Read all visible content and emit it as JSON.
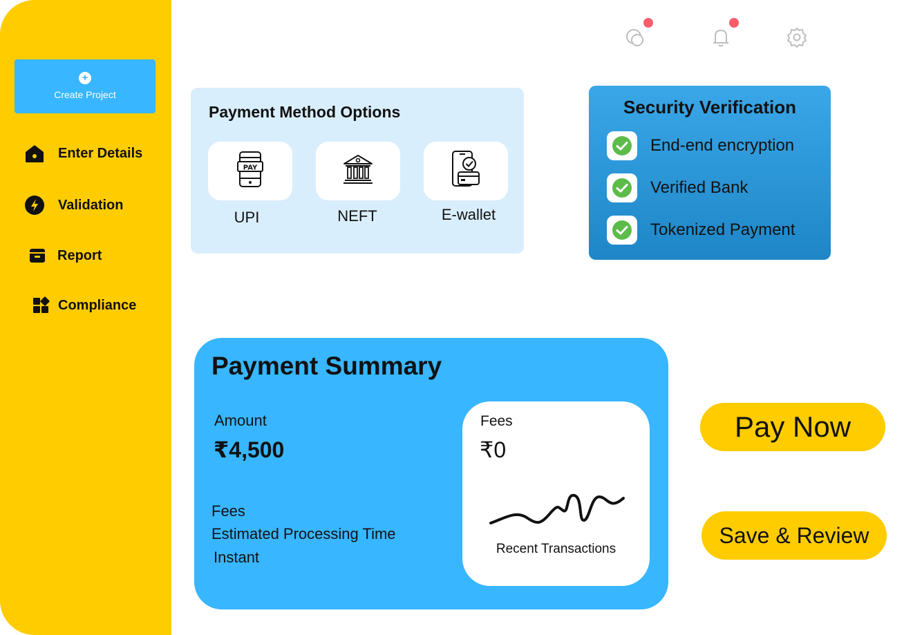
{
  "sidebar": {
    "create_label": "Create Project",
    "items": [
      {
        "label": "Enter Details",
        "icon": "home-icon"
      },
      {
        "label": "Validation",
        "icon": "lightning-icon"
      },
      {
        "label": "Report",
        "icon": "archive-icon"
      },
      {
        "label": "Compliance",
        "icon": "grid-icon"
      }
    ]
  },
  "header": {
    "icons": [
      "chat-icon",
      "bell-icon",
      "gear-icon"
    ],
    "notification_color": "#F95C6B"
  },
  "payment_methods": {
    "title": "Payment Method Options",
    "options": [
      {
        "label": "UPI",
        "icon": "phone-pay-icon",
        "icon_text": "PAY"
      },
      {
        "label": "NEFT",
        "icon": "bank-icon"
      },
      {
        "label": "E-wallet",
        "icon": "wallet-phone-icon"
      }
    ]
  },
  "security": {
    "title": "Security Verification",
    "items": [
      {
        "label": "End-end encryption"
      },
      {
        "label": "Verified Bank"
      },
      {
        "label": "Tokenized Payment"
      }
    ],
    "check_color": "#5DBB4A"
  },
  "summary": {
    "title": "Payment Summary",
    "amount_label": "Amount",
    "amount_value": "₹4,500",
    "fees_label": "Fees",
    "processing_label": "Estimated Processing Time",
    "processing_value": "Instant",
    "fees_card": {
      "label": "Fees",
      "value": "₹0",
      "chart_caption": "Recent Transactions"
    }
  },
  "actions": {
    "pay_now": "Pay Now",
    "save_review": "Save & Review"
  },
  "colors": {
    "sidebar": "#FFCC00",
    "accent_blue": "#38B6FF",
    "light_blue": "#D9EEFC",
    "button_yellow": "#FFCC00"
  }
}
